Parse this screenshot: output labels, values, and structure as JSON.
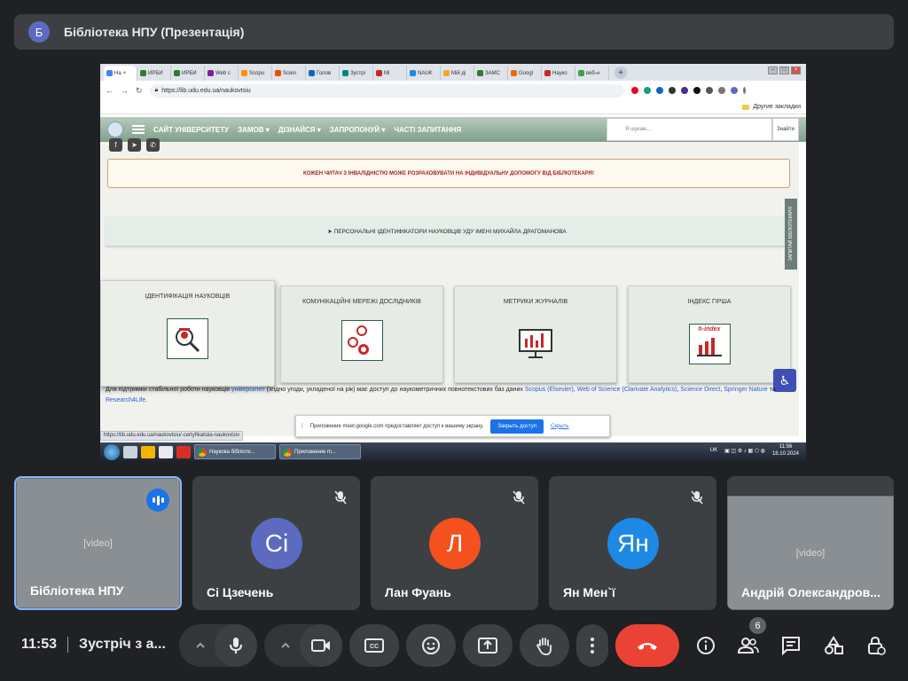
{
  "presentation": {
    "avatar_letter": "Б",
    "title": "Бібліотека НПУ (Презентація)"
  },
  "shared_screen": {
    "browser": {
      "tabs": [
        {
          "label": "На",
          "active": true,
          "color": "#4285f4"
        },
        {
          "label": "ИРБИ",
          "active": false,
          "color": "#2e7d32"
        },
        {
          "label": "ИРБИ",
          "active": false,
          "color": "#2e7d32"
        },
        {
          "label": "Web c",
          "active": false,
          "color": "#7b1fa2"
        },
        {
          "label": "Scopu",
          "active": false,
          "color": "#ff8f00"
        },
        {
          "label": "Scien",
          "active": false,
          "color": "#e65100"
        },
        {
          "label": "Голов",
          "active": false,
          "color": "#1565c0"
        },
        {
          "label": "Зустрі",
          "active": false,
          "color": "#00897b"
        },
        {
          "label": "Мі",
          "active": false,
          "color": "#c62828"
        },
        {
          "label": "NAUK",
          "active": false,
          "color": "#1e88e5"
        },
        {
          "label": "Мій ді",
          "active": false,
          "color": "#f9a825"
        },
        {
          "label": "ЗАМС",
          "active": false,
          "color": "#2e7d32"
        },
        {
          "label": "Googl",
          "active": false,
          "color": "#ef6c00"
        },
        {
          "label": "Науко",
          "active": false,
          "color": "#c62828"
        },
        {
          "label": "веб-н",
          "active": false,
          "color": "#43a047"
        }
      ],
      "new_tab": "+",
      "url": "https://lib.udu.edu.ua/naukovtsiu",
      "bookmarks_label": "Другие закладки"
    },
    "site": {
      "nav": [
        "САЙТ УНІВЕРСИТЕТУ",
        "ЗАМОВ",
        "ДІЗНАЙСЯ",
        "ЗАПРОПОНУЙ",
        "ЧАСТІ ЗАПИТАННЯ"
      ],
      "search_placeholder": "Я шукаю...",
      "search_button": "Знайти",
      "socials": [
        "f",
        "➤",
        "✆"
      ],
      "notice": "КОЖЕН ЧИТАЧ З ІНВАЛІДНІСТЮ МОЖЕ РОЗРАХОВУВАТИ НА ІНДИВІДУАЛЬНУ ДОПОМОГУ ВІД БІБЛІОТЕКАРЯ!",
      "identifiers": "➤ ПЕРСОНАЛЬНІ ІДЕНТИФІКАТОРИ НАУКОВЦІВ УДУ ІМЕНІ МИХАЙЛА ДРАГОМАНОВА",
      "feedback_tab": "ЗАПИТАЙ БІБЛІОТЕКАРЯ",
      "cards": [
        {
          "title": "ІДЕНТИФІКАЦІЯ НАУКОВЦІВ",
          "icon": "scholar-search-icon"
        },
        {
          "title": "КОМУНІКАЦІЙНІ МЕРЕЖІ ДОСЛІДНИКІВ",
          "icon": "network-people-icon"
        },
        {
          "title": "МЕТРИКИ ЖУРНАЛІВ",
          "icon": "monitor-chart-icon"
        },
        {
          "title": "ІНДЕКС ГІРША",
          "icon": "h-index-icon"
        }
      ],
      "h_index_label": "h-index",
      "body_text": {
        "prefix": "Для підтримки стабільної роботи науковців",
        "link1": "університет",
        "middle": "(згідно угоди, укладеної на рік) має доступ до наукометричних повнотекстових баз даних",
        "link2": "Scopus (Elsevier)",
        "link3": "Web of Science (Clarivate Analytics)",
        "link4": "Science Direct",
        "link5": "Springer Nature",
        "and": "та",
        "link6": "Research4Life"
      },
      "status_url": "https://lib.udu.edu.ua/naukovtsiu/-certyfikatsiia-naukovtsiv",
      "share_banner": {
        "text": "Приложение meet.google.com предоставляет доступ к вашему экрану.",
        "stop": "Закрыть доступ",
        "hide": "Скрыть"
      }
    },
    "taskbar": {
      "tasks": [
        "Наукова бібліоте...",
        "Приложение m..."
      ],
      "lang": "UK",
      "time": "11:56",
      "date": "18.10.2024"
    }
  },
  "participants": [
    {
      "name": "Бібліотека НПУ",
      "video": true,
      "speaking": true
    },
    {
      "name": "Сі Цзечень",
      "initials": "Сі",
      "color": "#5c6bc0",
      "muted": true
    },
    {
      "name": "Лан Фуань",
      "initials": "Л",
      "color": "#f4511e",
      "muted": true
    },
    {
      "name": "Ян Мен`ї",
      "initials": "Ян",
      "color": "#1e88e5",
      "muted": true
    },
    {
      "name": "Андрій Олександров...",
      "video": true
    }
  ],
  "footer": {
    "time": "11:53",
    "meeting_title": "Зустріч з а...",
    "participants_count": "6"
  }
}
